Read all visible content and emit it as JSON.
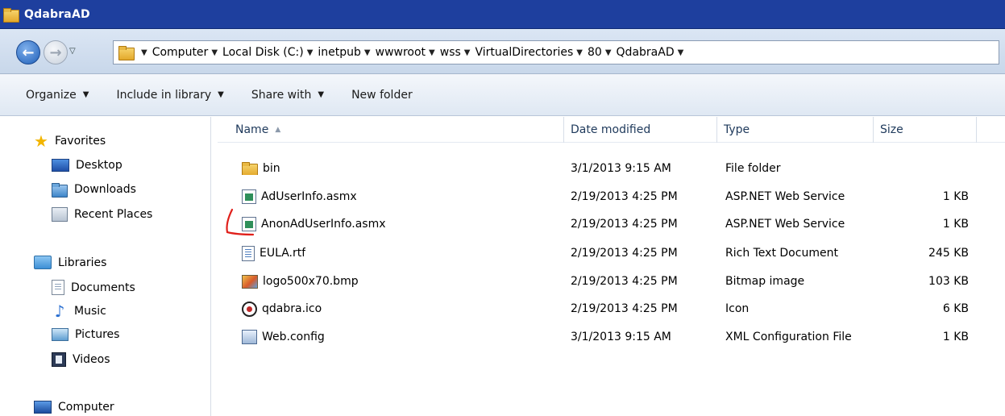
{
  "window": {
    "title": "QdabraAD"
  },
  "address": {
    "path": [
      "Computer",
      "Local Disk (C:)",
      "inetpub",
      "wwwroot",
      "wss",
      "VirtualDirectories",
      "80",
      "QdabraAD"
    ]
  },
  "toolbar": {
    "organize": "Organize",
    "include_in_library": "Include in library",
    "share_with": "Share with",
    "new_folder": "New folder"
  },
  "nav": {
    "favorites": "Favorites",
    "desktop": "Desktop",
    "downloads": "Downloads",
    "recent_places": "Recent Places",
    "libraries": "Libraries",
    "documents": "Documents",
    "music": "Music",
    "pictures": "Pictures",
    "videos": "Videos",
    "computer": "Computer"
  },
  "columns": {
    "name": "Name",
    "date": "Date modified",
    "type": "Type",
    "size": "Size"
  },
  "files": [
    {
      "name": "bin",
      "date": "3/1/2013 9:15 AM",
      "type": "File folder",
      "size": "",
      "icon": "folder-icon"
    },
    {
      "name": "AdUserInfo.asmx",
      "date": "2/19/2013 4:25 PM",
      "type": "ASP.NET Web Service",
      "size": "1 KB",
      "icon": "asmx-file-icon"
    },
    {
      "name": "AnonAdUserInfo.asmx",
      "date": "2/19/2013 4:25 PM",
      "type": "ASP.NET Web Service",
      "size": "1 KB",
      "icon": "asmx-file-icon"
    },
    {
      "name": "EULA.rtf",
      "date": "2/19/2013 4:25 PM",
      "type": "Rich Text Document",
      "size": "245 KB",
      "icon": "rtf-file-icon"
    },
    {
      "name": "logo500x70.bmp",
      "date": "2/19/2013 4:25 PM",
      "type": "Bitmap image",
      "size": "103 KB",
      "icon": "bitmap-file-icon"
    },
    {
      "name": "qdabra.ico",
      "date": "2/19/2013 4:25 PM",
      "type": "Icon",
      "size": "6 KB",
      "icon": "qdabra-ico-file-icon"
    },
    {
      "name": "Web.config",
      "date": "3/1/2013 9:15 AM",
      "type": "XML Configuration File",
      "size": "1 KB",
      "icon": "config-file-icon"
    }
  ],
  "colors": {
    "titlebar": "#1e3f9e",
    "annotation": "#e0201b"
  }
}
